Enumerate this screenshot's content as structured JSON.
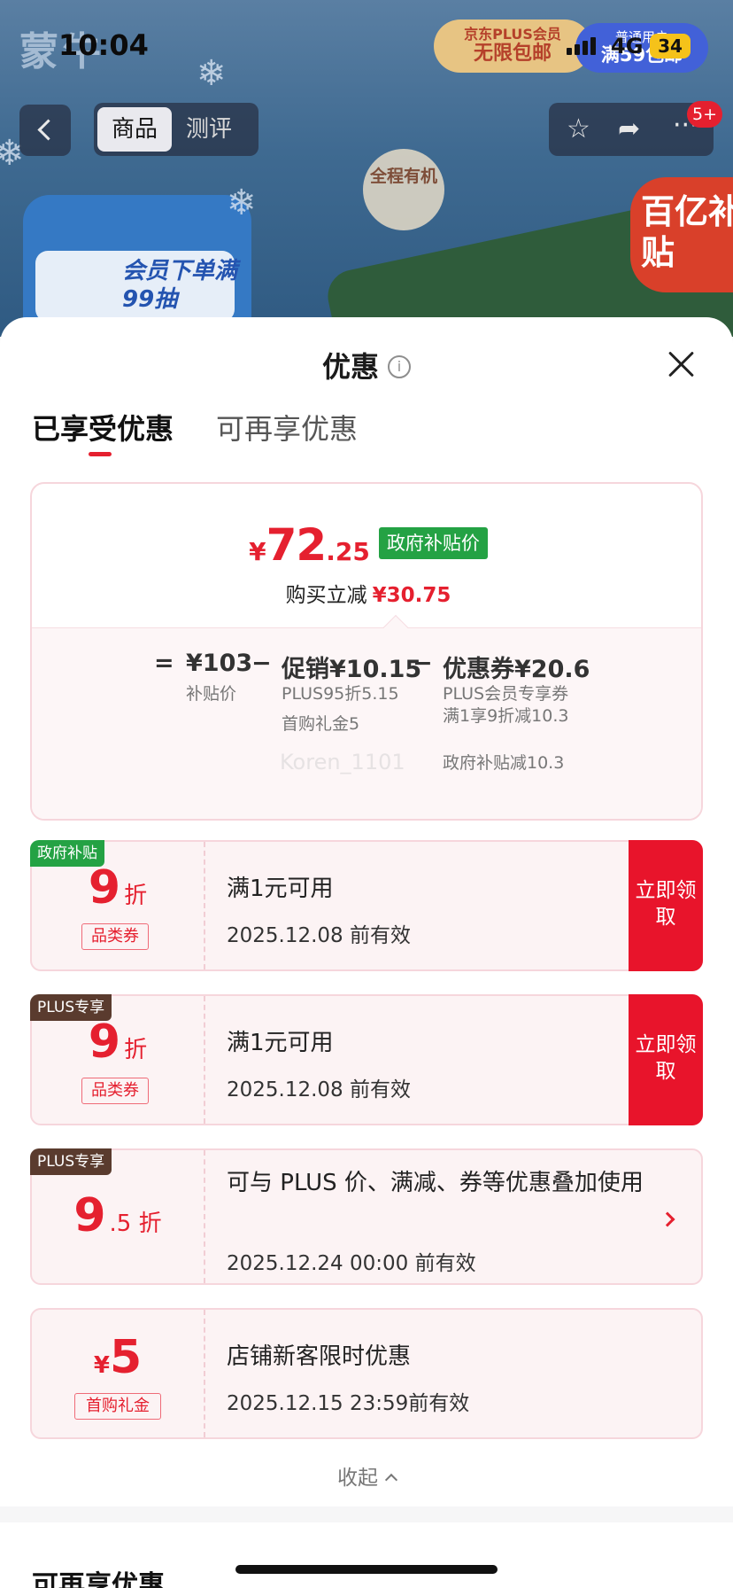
{
  "status_bar": {
    "time": "10:04",
    "network": "4G",
    "battery": "34"
  },
  "background": {
    "logo_text": "蒙牛",
    "plus_banner_top": "京东PLUS会员",
    "plus_banner_bottom": "无限包邮",
    "free_ship_top": "普通用户",
    "free_ship_bottom": "满59包邮",
    "organic_badge": "全程有机",
    "member_draw": "会员下单满99抽",
    "subsidy_badge": "百亿补贴",
    "tabs": [
      "商品",
      "测评"
    ],
    "badge_count": "5+"
  },
  "sheet": {
    "title": "优惠",
    "tabs": {
      "active": "已享受优惠",
      "inactive": "可再享优惠"
    },
    "summary": {
      "yen": "¥",
      "price_int": "72",
      "price_dec": ".25",
      "price_tag": "政府补贴价",
      "reduce_label": "购买立减",
      "reduce_value": "¥30.75",
      "equals": "=",
      "base_value": "¥103",
      "base_label": "补贴价",
      "minus1": "−",
      "promo_value": "促销¥10.15",
      "promo_detail_1": "PLUS95折5.15",
      "promo_detail_2": "首购礼金5",
      "minus2": "−",
      "coupon_value": "优惠券¥20.6",
      "coupon_detail_1": "PLUS会员专享券满1享9折减10.3",
      "coupon_detail_2": "政府补贴减10.3",
      "watermark": "Koren_1101"
    },
    "coupons": [
      {
        "tag": "政府补贴",
        "num": "9",
        "unit": "折",
        "kind": "品类券",
        "desc": "满1元可用",
        "date": "2025.12.08 前有效",
        "action": "立即领取"
      },
      {
        "tag": "PLUS专享",
        "num": "9",
        "unit": "折",
        "kind": "品类券",
        "desc": "满1元可用",
        "date": "2025.12.08 前有效",
        "action": "立即领取"
      },
      {
        "tag": "PLUS专享",
        "num": "9",
        "unit": ".5 折",
        "desc": "可与 PLUS 价、满减、券等优惠叠加使用",
        "date": "2025.12.24 00:00 前有效"
      },
      {
        "num": "5",
        "yen": "¥",
        "kind": "首购礼金",
        "desc": "店铺新客限时优惠",
        "date": "2025.12.15 23:59前有效"
      }
    ],
    "collapse_label": "收起",
    "next_section_title": "可再享优惠"
  },
  "colors": {
    "accent_red": "#e5202f",
    "gov_green": "#24a244",
    "plus_brown": "#5a3b2e"
  }
}
